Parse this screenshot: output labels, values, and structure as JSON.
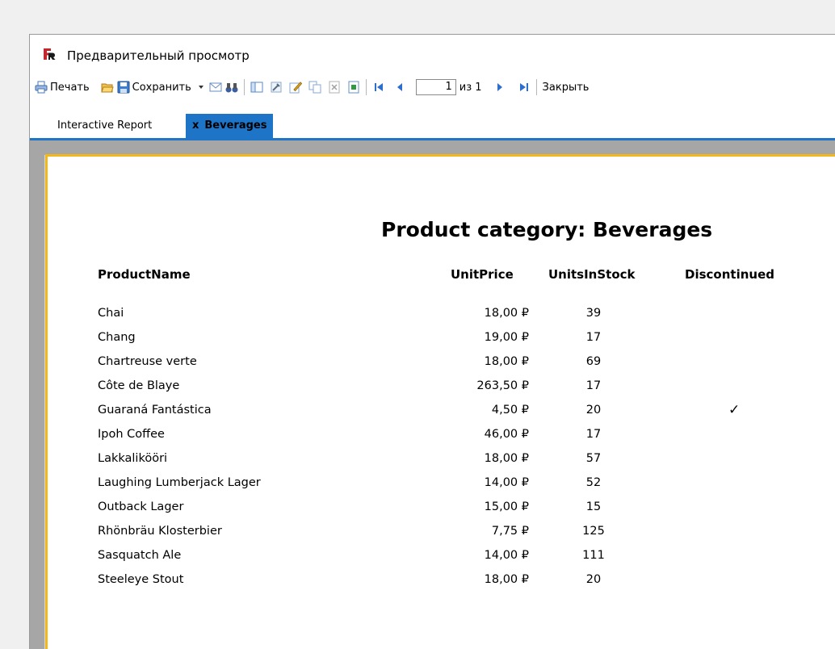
{
  "window": {
    "title": "Предварительный просмотр"
  },
  "toolbar": {
    "print_label": "Печать",
    "save_label": "Сохранить",
    "page_current": "1",
    "page_of": "из 1",
    "close_label": "Закрыть"
  },
  "tabs": [
    {
      "label": "Interactive Report",
      "active": false
    },
    {
      "label": "Beverages",
      "close_mark": "x",
      "active": true
    }
  ],
  "report": {
    "title": "Product category: Beverages",
    "headers": {
      "name": "ProductName",
      "price": "UnitPrice",
      "stock": "UnitsInStock",
      "discontinued": "Discontinued"
    },
    "rows": [
      {
        "name": "Chai",
        "price": "18,00 ₽",
        "stock": "39",
        "discontinued": ""
      },
      {
        "name": "Chang",
        "price": "19,00 ₽",
        "stock": "17",
        "discontinued": ""
      },
      {
        "name": "Chartreuse verte",
        "price": "18,00 ₽",
        "stock": "69",
        "discontinued": ""
      },
      {
        "name": "Côte de Blaye",
        "price": "263,50 ₽",
        "stock": "17",
        "discontinued": ""
      },
      {
        "name": "Guaraná Fantástica",
        "price": "4,50 ₽",
        "stock": "20",
        "discontinued": "✓"
      },
      {
        "name": "Ipoh Coffee",
        "price": "46,00 ₽",
        "stock": "17",
        "discontinued": ""
      },
      {
        "name": "Lakkalikööri",
        "price": "18,00 ₽",
        "stock": "57",
        "discontinued": ""
      },
      {
        "name": "Laughing Lumberjack Lager",
        "price": "14,00 ₽",
        "stock": "52",
        "discontinued": ""
      },
      {
        "name": "Outback Lager",
        "price": "15,00 ₽",
        "stock": "15",
        "discontinued": ""
      },
      {
        "name": "Rhönbräu Klosterbier",
        "price": "7,75 ₽",
        "stock": "125",
        "discontinued": ""
      },
      {
        "name": "Sasquatch Ale",
        "price": "14,00 ₽",
        "stock": "111",
        "discontinued": ""
      },
      {
        "name": "Steeleye Stout",
        "price": "18,00 ₽",
        "stock": "20",
        "discontinued": ""
      }
    ]
  },
  "colors": {
    "accent": "#1e74c6",
    "page_border": "#f2b71b",
    "logo": "#c1272d"
  }
}
